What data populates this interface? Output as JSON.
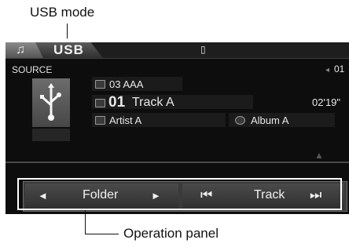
{
  "callouts": {
    "usb_mode": "USB mode",
    "operation_panel": "Operation panel"
  },
  "topbar": {
    "music_tab_icon": "music-note-icon",
    "usb_tab_label": "USB",
    "center_icon": "usb-device-icon"
  },
  "source": {
    "label": "SOURCE",
    "icon": "usb-icon"
  },
  "track_info": {
    "folder": {
      "icon": "folder-icon",
      "text": "03  AAA"
    },
    "track": {
      "icon": "music-file-icon",
      "number": "01",
      "name": "Track A",
      "time": "02'19\""
    },
    "artist": {
      "icon": "artist-icon",
      "text": "Artist A"
    },
    "album": {
      "icon": "album-icon",
      "text": "Album A"
    },
    "volume": {
      "icon": "volume-icon",
      "value": "01"
    }
  },
  "operation_panel": {
    "folder_prev": "◄",
    "folder_label": "Folder",
    "folder_next": "►",
    "track_prev": "⏮",
    "track_label": "Track",
    "track_next": "⏭"
  }
}
